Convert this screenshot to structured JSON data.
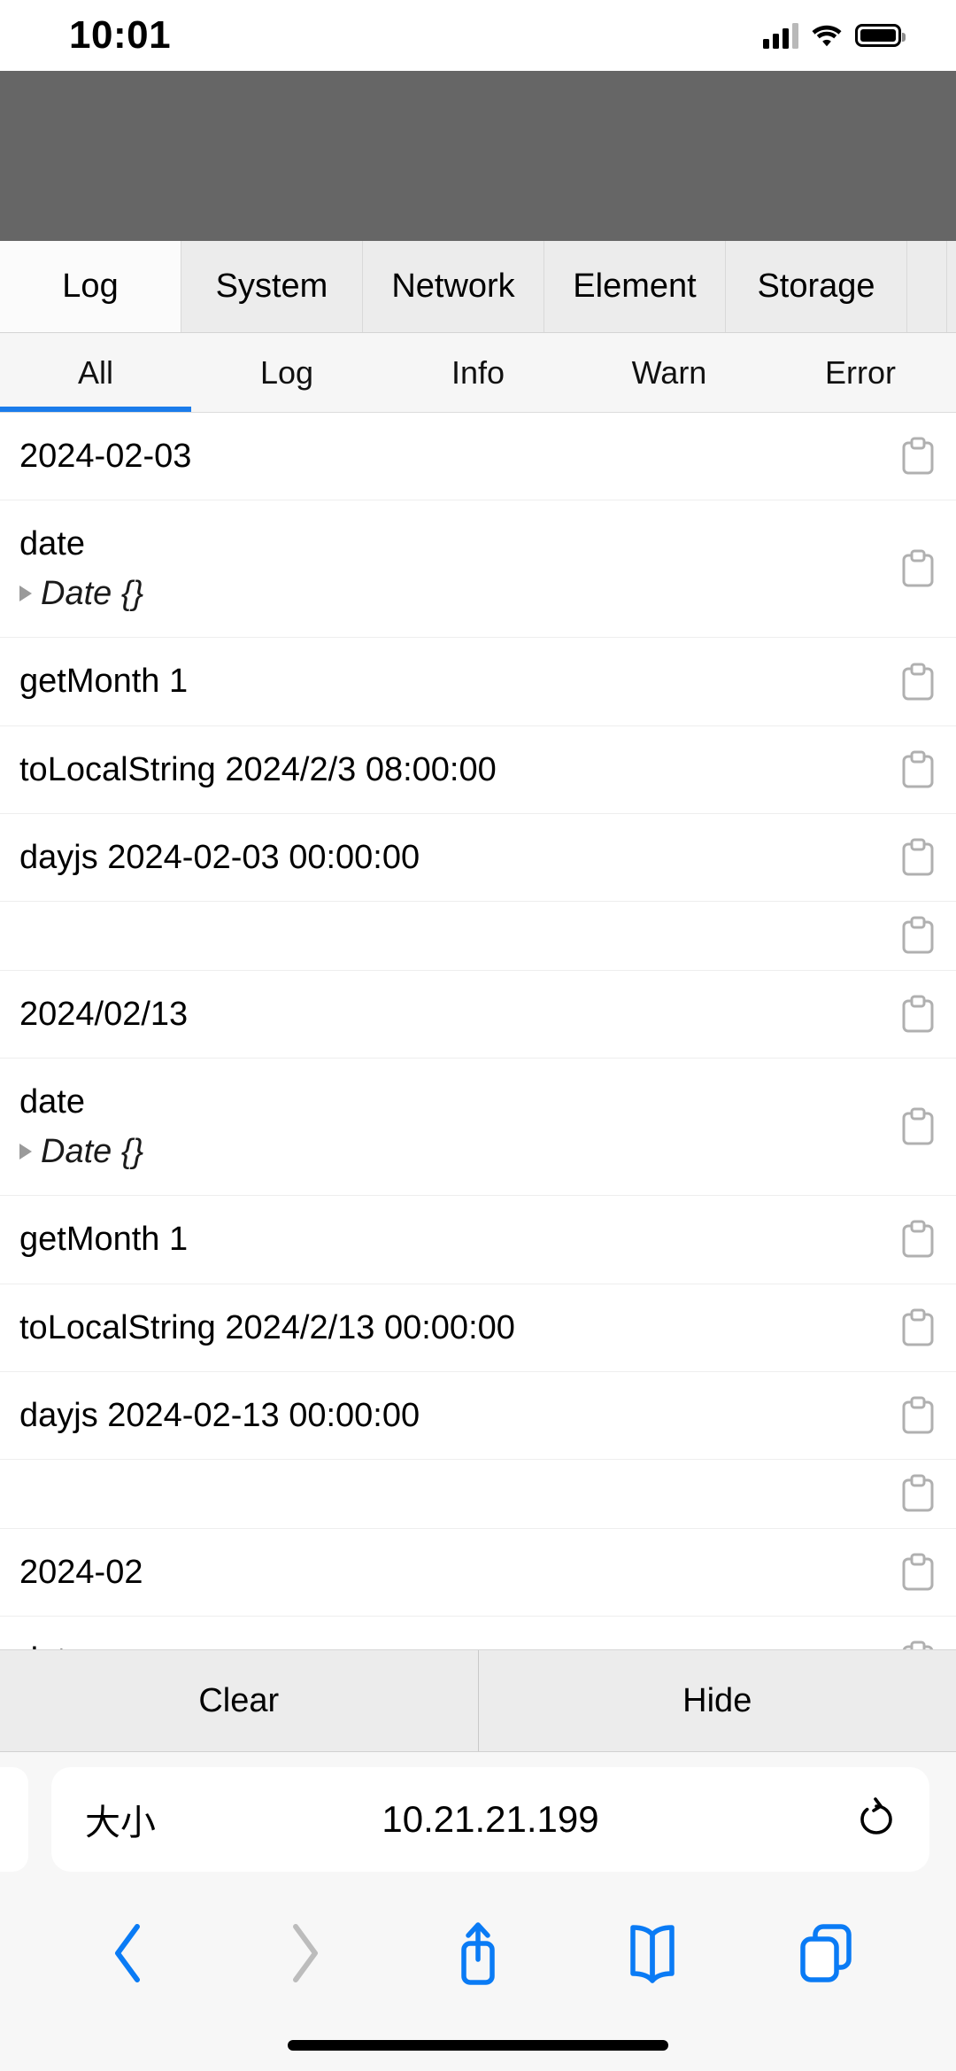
{
  "status_bar": {
    "time": "10:01",
    "signal_icon": "cellular-signal-icon",
    "wifi_icon": "wifi-icon",
    "battery_icon": "battery-icon"
  },
  "console": {
    "tabs": [
      {
        "label": "Log",
        "active": true
      },
      {
        "label": "System",
        "active": false
      },
      {
        "label": "Network",
        "active": false
      },
      {
        "label": "Element",
        "active": false
      },
      {
        "label": "Storage",
        "active": false
      },
      {
        "label": "",
        "active": false
      }
    ],
    "filters": [
      {
        "label": "All",
        "active": true
      },
      {
        "label": "Log",
        "active": false
      },
      {
        "label": "Info",
        "active": false
      },
      {
        "label": "Warn",
        "active": false
      },
      {
        "label": "Error",
        "active": false
      }
    ],
    "accent_color": "#1b7ceb",
    "copy_icon": "clipboard-copy-icon",
    "expand_icon": "disclosure-triangle-icon",
    "rows": [
      {
        "text": "2024-02-03",
        "sub": ""
      },
      {
        "text": "date",
        "sub": "Date {}"
      },
      {
        "text": "getMonth 1",
        "sub": ""
      },
      {
        "text": "toLocalString 2024/2/3 08:00:00",
        "sub": ""
      },
      {
        "text": "dayjs 2024-02-03 00:00:00",
        "sub": ""
      },
      {
        "text": "",
        "sub": ""
      },
      {
        "text": "2024/02/13",
        "sub": ""
      },
      {
        "text": "date",
        "sub": "Date {}"
      },
      {
        "text": "getMonth 1",
        "sub": ""
      },
      {
        "text": "toLocalString 2024/2/13 00:00:00",
        "sub": ""
      },
      {
        "text": "dayjs 2024-02-13 00:00:00",
        "sub": ""
      },
      {
        "text": "",
        "sub": ""
      },
      {
        "text": "2024-02",
        "sub": ""
      },
      {
        "text": "date",
        "sub": ""
      }
    ],
    "footer": {
      "clear_label": "Clear",
      "hide_label": "Hide"
    }
  },
  "browser": {
    "size_button_label": "大小",
    "url": "10.21.21.199",
    "reload_icon": "reload-icon",
    "back_icon": "chevron-left-icon",
    "forward_icon": "chevron-right-icon",
    "share_icon": "share-icon",
    "bookmarks_icon": "book-icon",
    "tabs_icon": "tabs-icon"
  }
}
